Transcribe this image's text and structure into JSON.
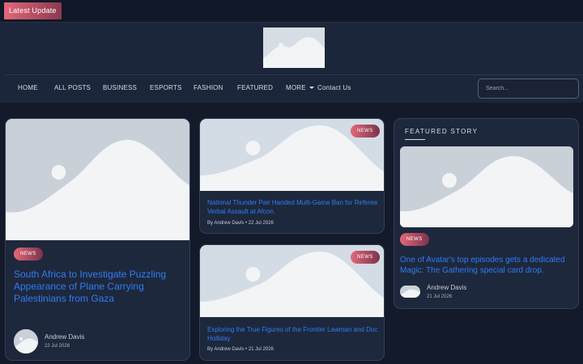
{
  "topbar": {
    "latest_label": "Latest Update"
  },
  "nav": {
    "items": [
      "HOME",
      "ALL POSTS",
      "BUSINESS",
      "ESPORTS",
      "FASHION",
      "FEATURED",
      "MORE",
      "Contact Us"
    ],
    "search_placeholder": "Search..."
  },
  "main_post": {
    "badge": "NEWS",
    "title": "South Africa to Investigate Puzzling Appearance of Plane Carrying Palestinians from Gaza",
    "author": "Andrew Davis",
    "date": "22 Jul 2026"
  },
  "middle_posts": [
    {
      "badge": "NEWS",
      "title": "National Thunder Pair Handed Multi-Game Ban for Referee Verbal Assault at Afcon.",
      "meta": "By Andrew Davis  • 22 Jul 2026"
    },
    {
      "badge": "NEWS",
      "title": "Exploring the True Figures of the Frontier Lawman and Doc Holliday",
      "meta": "By Andrew Davis  • 21 Jul 2026"
    }
  ],
  "featured": {
    "label": "FEATURED STORY",
    "badge": "NEWS",
    "title": "One of Avatar's top episodes gets a dedicated Magic: The Gathering special card drop.",
    "author": "Andrew Davis",
    "date": "21 Jul 2026"
  },
  "colors": {
    "accent_link": "#2e7cf6",
    "badge_gradient_start": "#e4677a",
    "badge_gradient_end": "#7b334a",
    "background": "#131a2a"
  }
}
